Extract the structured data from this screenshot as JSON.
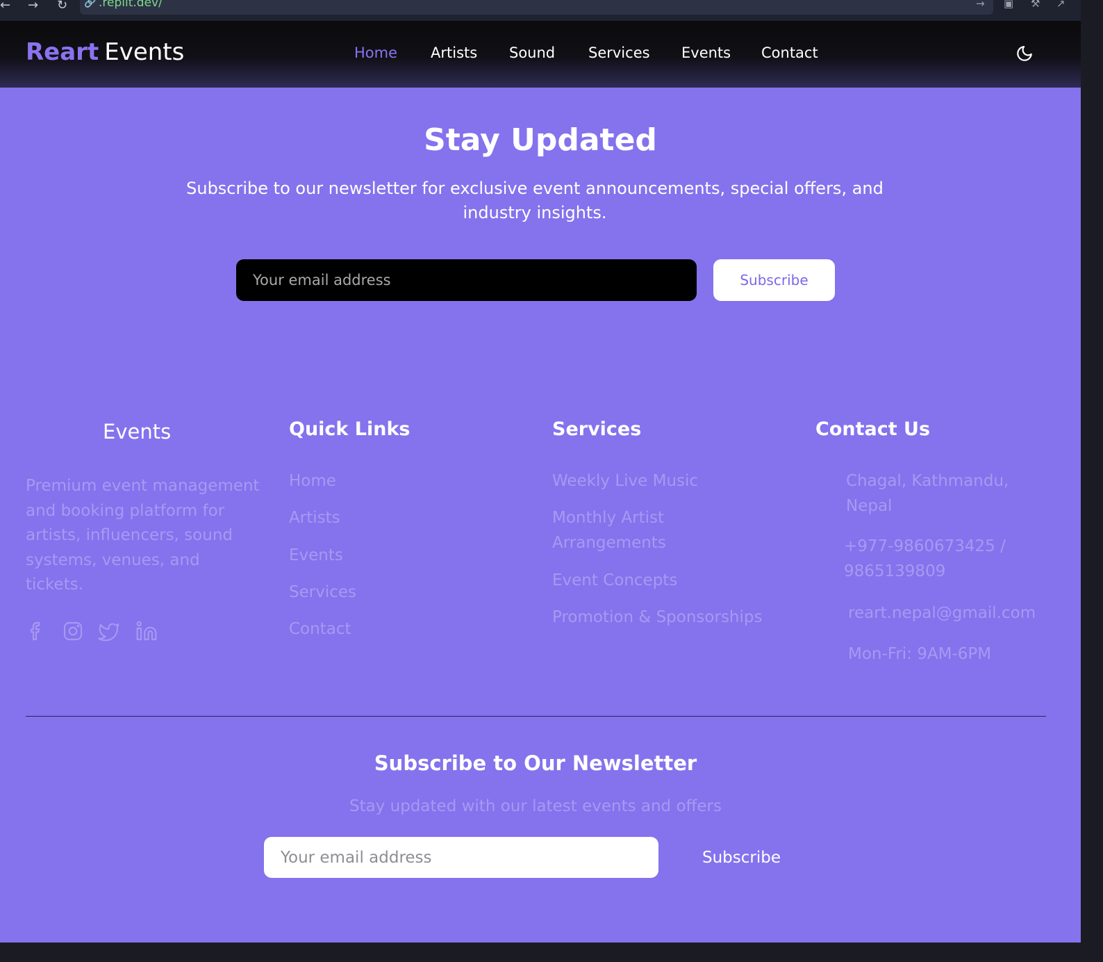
{
  "browser": {
    "url": ".replit.dev/",
    "back_icon": "arrow-left-icon",
    "forward_icon": "arrow-right-icon",
    "reload_icon": "reload-icon"
  },
  "header": {
    "brand": "Reart",
    "brand_rest": "Events",
    "nav": [
      "Home",
      "Artists",
      "Sound",
      "Services",
      "Events",
      "Contact"
    ],
    "active_nav": "Home",
    "theme_icon": "moon-icon"
  },
  "stay_updated": {
    "title": "Stay Updated",
    "subtitle": "Subscribe to our newsletter for exclusive event announcements, special offers, and industry insights.",
    "email_placeholder": "Your email address",
    "button": "Subscribe"
  },
  "footer": {
    "brand_title": "Events",
    "about": "Premium event management and booking platform for artists, influencers, sound systems, venues, and tickets.",
    "social": [
      "facebook-icon",
      "instagram-icon",
      "twitter-icon",
      "linkedin-icon"
    ],
    "quick_links_title": "Quick Links",
    "quick_links": [
      "Home",
      "Artists",
      "Events",
      "Services",
      "Contact"
    ],
    "services_title": "Services",
    "services": [
      "Weekly Live Music",
      "Monthly Artist Arrangements",
      "Event Concepts",
      "Promotion & Sponsorships"
    ],
    "contact_title": "Contact Us",
    "contact": {
      "address": "Chagal, Kathmandu, Nepal",
      "phone": "+977-9860673425 / 9865139809",
      "email": "reart.nepal@gmail.com",
      "hours": "Mon-Fri: 9AM-6PM"
    }
  },
  "newsletter": {
    "title": "Subscribe to Our Newsletter",
    "subtitle": "Stay updated with our latest events and offers",
    "email_placeholder": "Your email address",
    "button": "Subscribe"
  },
  "colors": {
    "accent": "#8b73f0",
    "background": "#8572ed",
    "header": "#0b0b0d",
    "muted_text": "#a899f2"
  }
}
